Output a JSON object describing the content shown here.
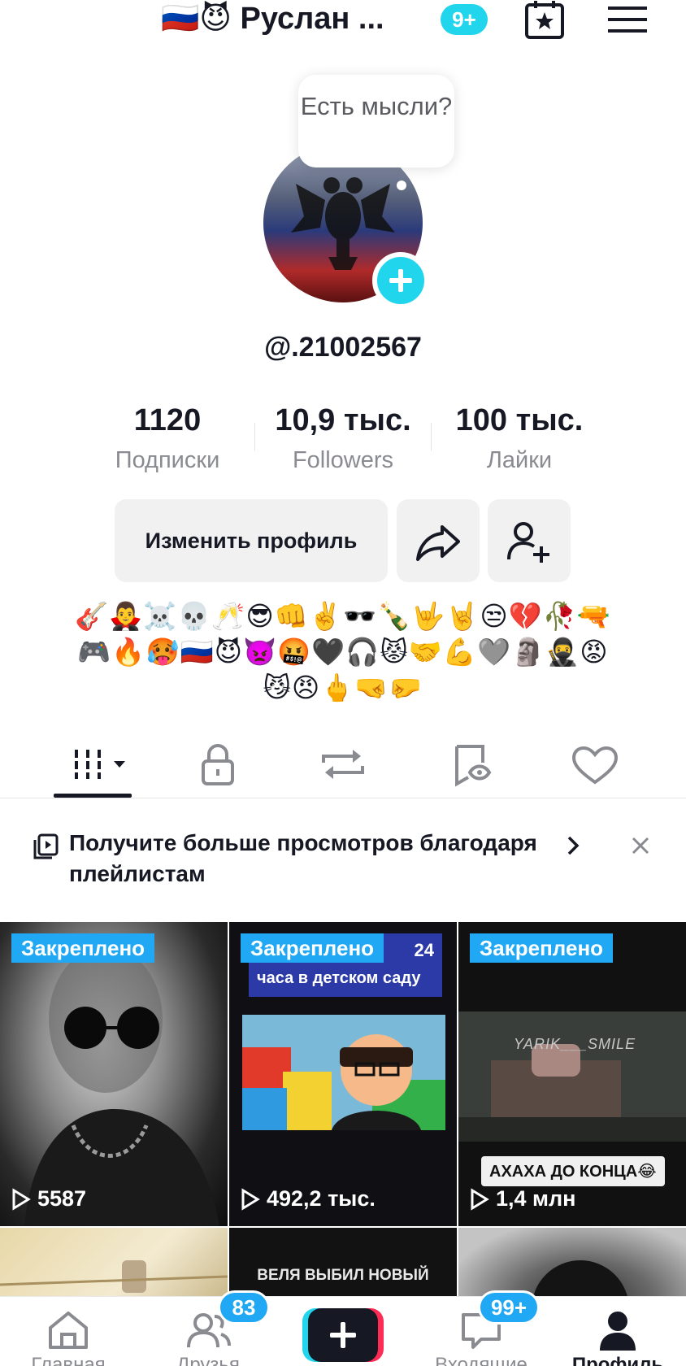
{
  "header": {
    "title": "🇷🇺😈 Руслан ...",
    "notification_badge": "9+"
  },
  "profile": {
    "bubble_text": "Есть мысли?",
    "username": "@.21002567"
  },
  "stats": [
    {
      "value": "1120",
      "label": "Подписки"
    },
    {
      "value": "10,9 тыс.",
      "label": "Followers"
    },
    {
      "value": "100 тыс.",
      "label": "Лайки"
    }
  ],
  "actions": {
    "edit_label": "Изменить профиль"
  },
  "bio": "🎸🧛‍♂️☠️💀🥂😎👊✌️🕶️🍾🤟🤘😒💔🥀🔫🎮🔥🥵🇷🇺😈👿🤬🖤🎧😾🤝💪🩶🗿🥷😡😼😠🖕🤜🤛",
  "tabs": [
    "videos-grid",
    "private",
    "reposts",
    "favorites",
    "liked"
  ],
  "banner": {
    "text": "Получите больше просмотров благодаря плейлистам"
  },
  "videos": [
    {
      "pinned": "Закреплено",
      "views": "5587",
      "overlay": ""
    },
    {
      "pinned": "Закреплено",
      "views": "492,2 тыс.",
      "overlay": "24 часа в детском саду"
    },
    {
      "pinned": "Закреплено",
      "views": "1,4 млн",
      "overlay": "АХАХА ДО КОНЦА😂"
    },
    {
      "pinned": "",
      "views": "",
      "overlay": ""
    },
    {
      "pinned": "",
      "views": "",
      "overlay": "ВЕЛЯ ВЫБИЛ НОВЫЙ"
    },
    {
      "pinned": "",
      "views": "",
      "overlay": ""
    }
  ],
  "video_tile_2_top": "24",
  "video_tile_2_sub": "часа в детском саду",
  "video_tile_3_watermark": "YARIK___SMILE",
  "nav": {
    "home": "Главная",
    "friends": "Друзья",
    "friends_badge": "83",
    "inbox": "Входящие",
    "inbox_badge": "99+",
    "profile": "Профиль"
  },
  "colors": {
    "accent": "#20d5ec",
    "pin_badge": "#20a8f5",
    "text": "#161823",
    "muted": "#8a8b91"
  }
}
